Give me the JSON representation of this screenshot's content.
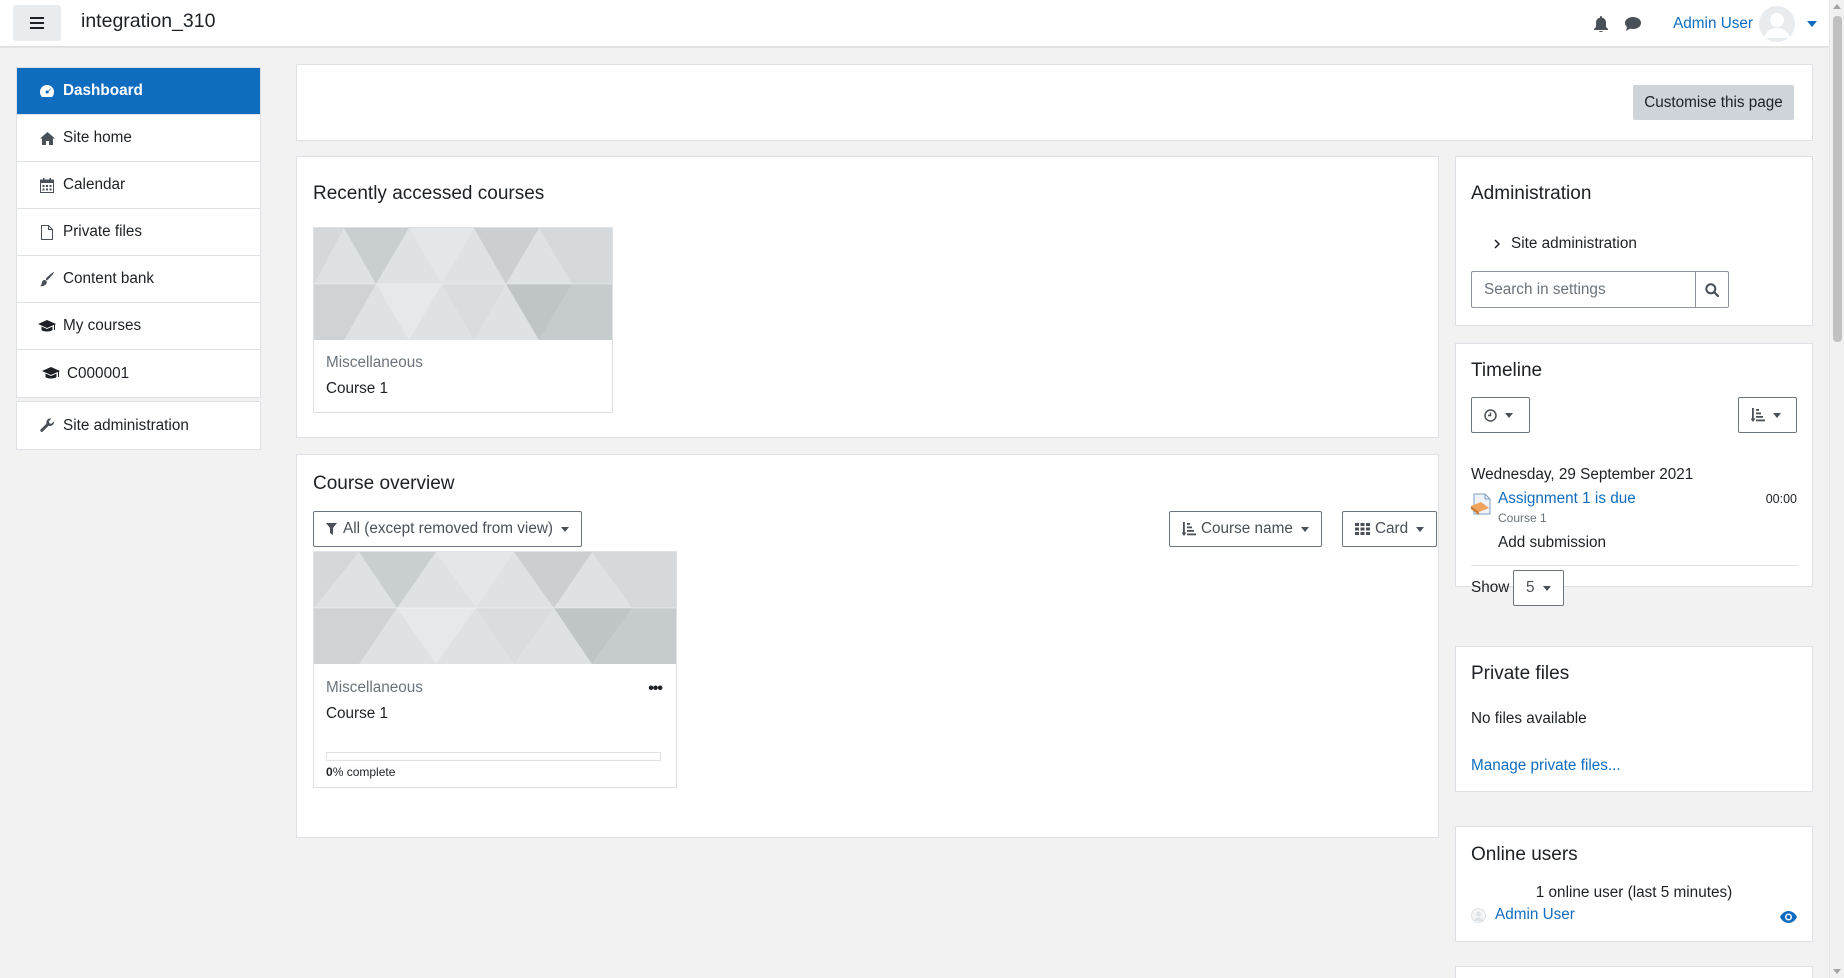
{
  "navbar": {
    "site_name": "integration_310",
    "user_name": "Admin User"
  },
  "drawer": {
    "items": [
      {
        "label": "Dashboard",
        "icon": "dashboard-icon",
        "active": true
      },
      {
        "label": "Site home",
        "icon": "home-icon"
      },
      {
        "label": "Calendar",
        "icon": "calendar-icon"
      },
      {
        "label": "Private files",
        "icon": "file-icon"
      },
      {
        "label": "Content bank",
        "icon": "paintbrush-icon"
      },
      {
        "label": "My courses",
        "icon": "graduation-cap-icon"
      },
      {
        "label": "C000001",
        "icon": "graduation-cap-icon"
      }
    ],
    "admin_item": {
      "label": "Site administration",
      "icon": "wrench-icon"
    }
  },
  "page_header": {
    "customise_label": "Customise this page"
  },
  "recent_courses": {
    "title": "Recently accessed courses",
    "course": {
      "category": "Miscellaneous",
      "name": "Course 1"
    }
  },
  "course_overview": {
    "title": "Course overview",
    "filter_label": "All (except removed from view)",
    "sort_label": "Course name",
    "view_label": "Card",
    "course": {
      "category": "Miscellaneous",
      "name": "Course 1",
      "progress_pct": "0",
      "progress_suffix": "% complete",
      "progress_value": 0
    }
  },
  "admin_block": {
    "title": "Administration",
    "site_admin_label": "Site administration",
    "search_placeholder": "Search in settings"
  },
  "timeline": {
    "title": "Timeline",
    "date": "Wednesday, 29 September 2021",
    "event": {
      "name": "Assignment 1 is due",
      "course": "Course 1",
      "time": "00:00",
      "action": "Add submission"
    },
    "show_label": "Show",
    "show_value": "5"
  },
  "private_files": {
    "title": "Private files",
    "empty_text": "No files available",
    "manage_link": "Manage private files..."
  },
  "online_users": {
    "title": "Online users",
    "summary": "1 online user (last 5 minutes)",
    "user": "Admin User"
  },
  "colors": {
    "primary": "#0f6cbf",
    "secondary_button": "#ced4da",
    "page_bg": "#f2f2f2"
  }
}
